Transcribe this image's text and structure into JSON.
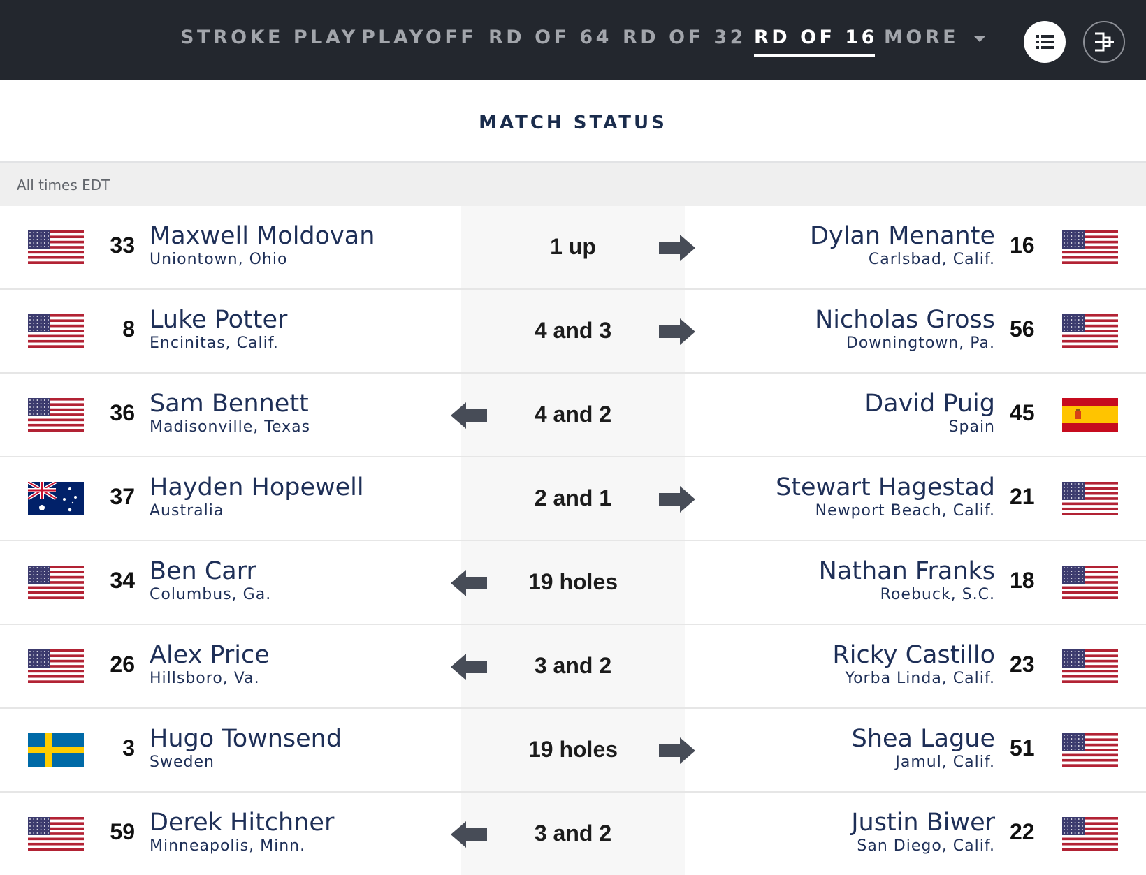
{
  "nav": {
    "tabs": [
      {
        "label": "STROKE PLAY",
        "active": false
      },
      {
        "label": "PLAYOFF",
        "active": false
      },
      {
        "label": "RD OF 64",
        "active": false
      },
      {
        "label": "RD OF 32",
        "active": false
      },
      {
        "label": "RD OF 16",
        "active": true
      },
      {
        "label": "MORE",
        "active": false,
        "dropdown": true
      }
    ],
    "icons": [
      "list-view-icon",
      "bracket-view-icon"
    ]
  },
  "header": {
    "title": "MATCH STATUS",
    "time_note": "All times EDT"
  },
  "matches": [
    {
      "left": {
        "seed": "33",
        "name": "Maxwell Moldovan",
        "location": "Uniontown, Ohio",
        "flag": "usa"
      },
      "result": "1 up",
      "winner": "left",
      "right": {
        "seed": "16",
        "name": "Dylan Menante",
        "location": "Carlsbad, Calif.",
        "flag": "usa"
      }
    },
    {
      "left": {
        "seed": "8",
        "name": "Luke Potter",
        "location": "Encinitas, Calif.",
        "flag": "usa"
      },
      "result": "4 and 3",
      "winner": "left",
      "right": {
        "seed": "56",
        "name": "Nicholas Gross",
        "location": "Downingtown, Pa.",
        "flag": "usa"
      }
    },
    {
      "left": {
        "seed": "36",
        "name": "Sam Bennett",
        "location": "Madisonville, Texas",
        "flag": "usa"
      },
      "result": "4 and 2",
      "winner": "right",
      "right": {
        "seed": "45",
        "name": "David Puig",
        "location": "Spain",
        "flag": "spain"
      }
    },
    {
      "left": {
        "seed": "37",
        "name": "Hayden Hopewell",
        "location": "Australia",
        "flag": "australia"
      },
      "result": "2 and 1",
      "winner": "left",
      "right": {
        "seed": "21",
        "name": "Stewart Hagestad",
        "location": "Newport Beach, Calif.",
        "flag": "usa"
      }
    },
    {
      "left": {
        "seed": "34",
        "name": "Ben Carr",
        "location": "Columbus, Ga.",
        "flag": "usa"
      },
      "result": "19 holes",
      "winner": "right",
      "right": {
        "seed": "18",
        "name": "Nathan Franks",
        "location": "Roebuck, S.C.",
        "flag": "usa"
      }
    },
    {
      "left": {
        "seed": "26",
        "name": "Alex Price",
        "location": "Hillsboro, Va.",
        "flag": "usa"
      },
      "result": "3 and 2",
      "winner": "right",
      "right": {
        "seed": "23",
        "name": "Ricky Castillo",
        "location": "Yorba Linda, Calif.",
        "flag": "usa"
      }
    },
    {
      "left": {
        "seed": "3",
        "name": "Hugo Townsend",
        "location": "Sweden",
        "flag": "sweden"
      },
      "result": "19 holes",
      "winner": "left",
      "right": {
        "seed": "51",
        "name": "Shea Lague",
        "location": "Jamul, Calif.",
        "flag": "usa"
      }
    },
    {
      "left": {
        "seed": "59",
        "name": "Derek Hitchner",
        "location": "Minneapolis, Minn.",
        "flag": "usa"
      },
      "result": "3 and 2",
      "winner": "right",
      "right": {
        "seed": "22",
        "name": "Justin Biwer",
        "location": "San Diego, Calif.",
        "flag": "usa"
      }
    }
  ],
  "colors": {
    "nav_bg": "#23272e",
    "nav_tab": "#a2a5ab",
    "nav_active": "#ffffff",
    "name_text": "#1e2f57",
    "arrow": "#474c57",
    "center_col": "#f7f7f7",
    "usa_red": "#b22234",
    "usa_blue": "#3c3b6e",
    "spain_red": "#c60b1e",
    "spain_yellow": "#ffc400",
    "sweden_blue": "#006aa7",
    "sweden_yellow": "#fecc00",
    "australia_blue": "#012169"
  }
}
